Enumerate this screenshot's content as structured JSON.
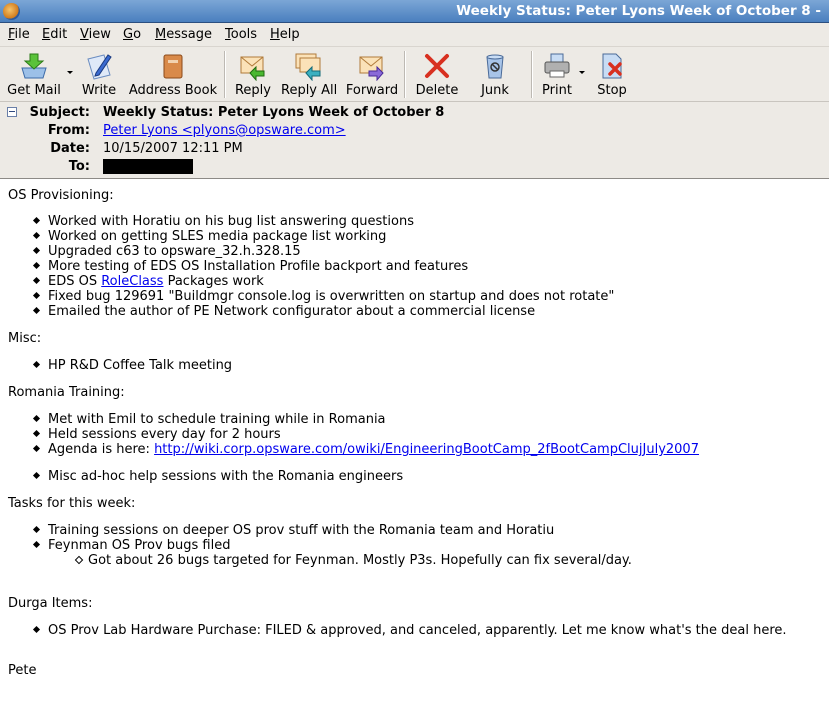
{
  "window": {
    "title": "Weekly Status: Peter Lyons Week of October 8 -"
  },
  "menu": [
    "File",
    "Edit",
    "View",
    "Go",
    "Message",
    "Tools",
    "Help"
  ],
  "toolbar": {
    "get_mail": "Get Mail",
    "write": "Write",
    "address_book": "Address Book",
    "reply": "Reply",
    "reply_all": "Reply All",
    "forward": "Forward",
    "delete": "Delete",
    "junk": "Junk",
    "print": "Print",
    "stop": "Stop"
  },
  "header": {
    "subject_label": "Subject:",
    "subject": "Weekly Status: Peter Lyons Week of October 8",
    "from_label": "From:",
    "from": "Peter Lyons <plyons@opsware.com>",
    "date_label": "Date:",
    "date": "10/15/2007 12:11 PM",
    "to_label": "To:"
  },
  "body": {
    "os_heading": "OS Provisioning:",
    "os_items": [
      "Worked with Horatiu on his bug list answering questions",
      "Worked on getting SLES media package list working",
      "Upgraded c63 to opsware_32.h.328.15",
      "More testing of EDS OS Installation Profile backport and features"
    ],
    "os_roleclass": {
      "pre": "EDS OS ",
      "link": "RoleClass",
      "post": " Packages work"
    },
    "os_items2": [
      "Fixed bug 129691 \"Buildmgr console.log is overwritten on startup and does not rotate\"",
      "Emailed the author of PE Network configurator about a commercial license"
    ],
    "misc_heading": "Misc:",
    "misc_items": [
      "HP R&D Coffee Talk meeting"
    ],
    "romania_heading": "Romania Training:",
    "romania_items": [
      "Met with Emil to schedule training while in Romania",
      "Held sessions every day for 2 hours"
    ],
    "agenda_prefix": "Agenda is here: ",
    "agenda_link": "http://wiki.corp.opsware.com/owiki/EngineeringBootCamp_2fBootCampClujJuly2007",
    "romania_last": "Misc ad-hoc help sessions with the Romania engineers",
    "tasks_heading": "Tasks for this week:",
    "tasks_items": [
      "Training sessions on deeper OS prov stuff with the Romania team and Horatiu",
      "Feynman OS Prov bugs filed"
    ],
    "tasks_sub": "Got about 26 bugs targeted for Feynman.  Mostly P3s. Hopefully can fix several/day.",
    "durga_heading": "Durga Items:",
    "durga_items": [
      "OS Prov Lab Hardware Purchase: FILED & approved, and canceled, apparently.  Let me know what's the deal here."
    ],
    "signature": "Pete"
  }
}
